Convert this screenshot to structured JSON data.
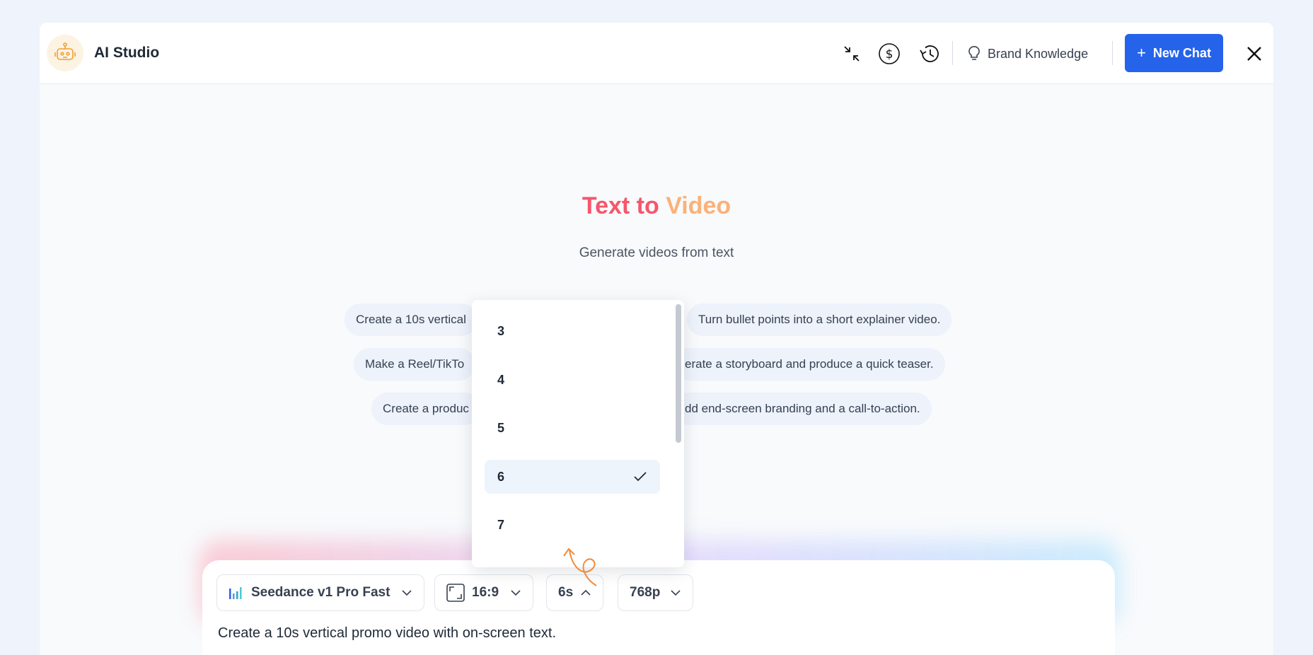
{
  "app": {
    "title": "AI Studio",
    "logo_icon": "robot-icon"
  },
  "header": {
    "icons": [
      "collapse-icon",
      "dollar-icon",
      "history-icon"
    ],
    "brand_knowledge_label": "Brand Knowledge",
    "new_chat_label": "New Chat",
    "new_chat_icon": "plus-icon",
    "close_icon": "close-icon"
  },
  "hero": {
    "title_part1": "Text to ",
    "title_part2": "Video",
    "subtitle": "Generate videos from text"
  },
  "suggestions": [
    "Create a 10s vertical",
    "Turn bullet points into a short explainer video.",
    "Make a Reel/TikTo",
    "erate a storyboard and produce a quick teaser.",
    "Create a produc",
    "dd end-screen branding and a call-to-action."
  ],
  "composer": {
    "model_label": "Seedance v1 Pro Fast",
    "aspect_ratio_label": "16:9",
    "duration_label": "6s",
    "resolution_label": "768p",
    "prompt_text": "Create a 10s vertical promo video with on-screen text."
  },
  "duration_dropdown": {
    "options": [
      "3",
      "4",
      "5",
      "6",
      "7"
    ],
    "selected": "6"
  },
  "colors": {
    "accent": "#2563eb",
    "title_gradient_start": "#f5576c",
    "title_gradient_end": "#fbb17a",
    "annotation_arrow": "#f08a3c"
  }
}
